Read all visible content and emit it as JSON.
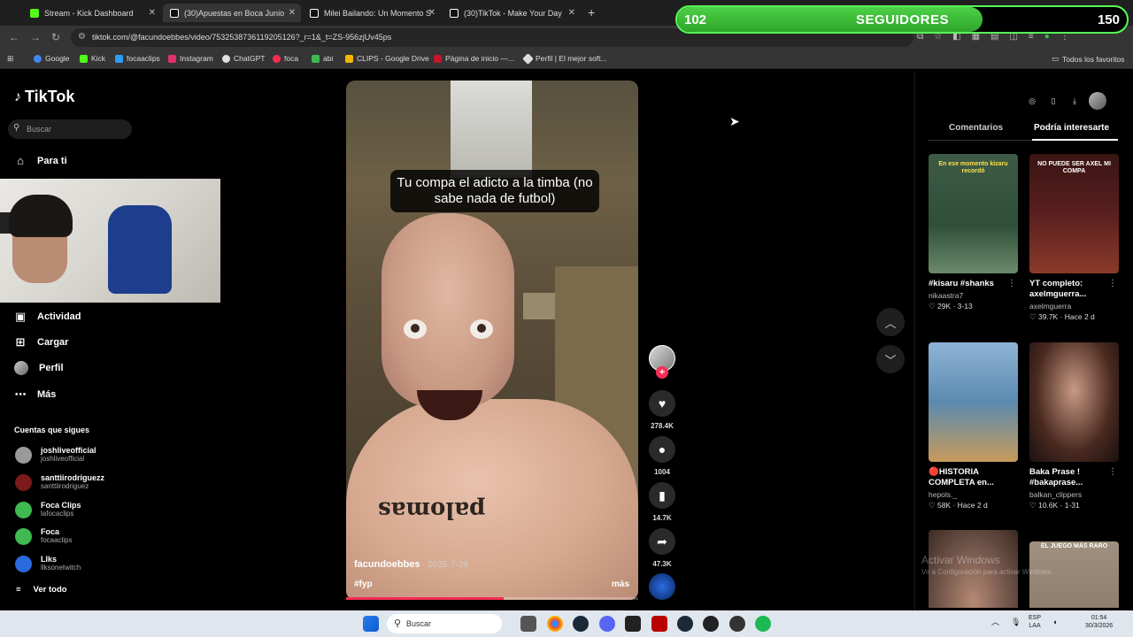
{
  "browser": {
    "tabs": [
      {
        "label": "Stream - Kick Dashboard",
        "color": "#53fc18",
        "active": false
      },
      {
        "label": "(30)Apuestas en Boca Junio",
        "color": "#ffffff",
        "active": true
      },
      {
        "label": "Milei Bailando: Un Momento S",
        "color": "#ffffff",
        "active": false
      },
      {
        "label": "(30)TikTok - Make Your Day",
        "color": "#ffffff",
        "active": false
      }
    ],
    "url": "tiktok.com/@facundoebbes/video/7532538736119205126?_r=1&_t=ZS-956zjUv45ps",
    "bookmarks": [
      {
        "label": "Google",
        "color": "#4285f4"
      },
      {
        "label": "Kick",
        "color": "#53fc18"
      },
      {
        "label": "focaaclips",
        "color": "#2a9df4"
      },
      {
        "label": "Instagram",
        "color": "#e1306c"
      },
      {
        "label": "ChatGPT",
        "color": "#e0e0e0"
      },
      {
        "label": "foca",
        "color": "#fe2c55"
      },
      {
        "label": "abi",
        "color": "#3fb950"
      },
      {
        "label": "CLIPS - Google Drive",
        "color": "#f4b400"
      },
      {
        "label": "Página de inicio —...",
        "color": "#c4162a"
      },
      {
        "label": "Perfil | El mejor soft...",
        "color": "#dddddd"
      }
    ],
    "all_bookmarks": "Todos los favoritos"
  },
  "followers": {
    "current": "102",
    "label": "SEGUIDORES",
    "goal": "150",
    "progress_fraction": 0.68
  },
  "sidebar": {
    "logo": "TikTok",
    "search_placeholder": "Buscar",
    "top_item": "Para ti",
    "items": [
      "Actividad",
      "Cargar",
      "Perfil",
      "Más"
    ],
    "following_title": "Cuentas que sigues",
    "accounts": [
      {
        "name": "joshliveofficial",
        "handle": "joshliveofficial",
        "color": "#9a9a9a"
      },
      {
        "name": "santtiirodriguezz",
        "handle": "santtiirodriguez",
        "color": "#7a1a1a"
      },
      {
        "name": "Foca Clips",
        "handle": "lafocaclips",
        "color": "#3fb950"
      },
      {
        "name": "Foca",
        "handle": "focaaclips",
        "color": "#3fb950"
      },
      {
        "name": "Llks",
        "handle": "llksonetwitch",
        "color": "#2a6ae0"
      }
    ],
    "see_all": "Ver todo"
  },
  "video": {
    "caption": "Tu compa el adicto a la timba (no sabe nada de futbol)",
    "username": "facundoebbes",
    "date": "· 2025-7-29",
    "hashtag": "#fyp",
    "more": "más",
    "progress_fraction": 0.54,
    "tattoo_text": "palomas"
  },
  "actions": {
    "likes": "278.4K",
    "comments": "1004",
    "saves": "14.7K",
    "shares": "47.3K"
  },
  "right_panel": {
    "tabs": [
      "Comentarios",
      "Podría interesarte"
    ],
    "cards": [
      {
        "title": "#kisaru #shanks",
        "author": "nikaastra7",
        "stats": "♡ 29K · 3-13",
        "thumb_text": "En ese momento kizaru recordó",
        "bg": "#2f4f3a"
      },
      {
        "title": "YT completo:\naxelmguerra...",
        "author": "axelmguerra",
        "stats": "♡ 39.7K · Hace 2 d",
        "thumb_text": "NO PUEDE SER AXEL MI COMPA",
        "bg": "#5a1f1f"
      },
      {
        "title": "🔴HISTORIA\nCOMPLETA en...",
        "author": "hepols._",
        "stats": "♡ 58K · Hace 2 d",
        "thumb_text": "",
        "bg": "#5a8ab0"
      },
      {
        "title": "Baka Prase !\n#bakaprase...",
        "author": "balkan_clippers",
        "stats": "♡ 10.6K · 1-31",
        "thumb_text": "",
        "bg": "#4a2a20"
      },
      {
        "title": "",
        "author": "",
        "stats": "",
        "thumb_text": "",
        "bg": "#6b5046"
      },
      {
        "title": "",
        "author": "",
        "stats": "",
        "thumb_text": "EL JUEGO MÁS RARO",
        "bg": "#807060"
      }
    ]
  },
  "watermark": {
    "title": "Activar Windows",
    "subtitle": "Ve a Configuración para activar Windows."
  },
  "taskbar": {
    "search_placeholder": "Buscar",
    "lang": "ESP",
    "region": "LAA",
    "time": "01:54",
    "date": "30/3/2026"
  }
}
